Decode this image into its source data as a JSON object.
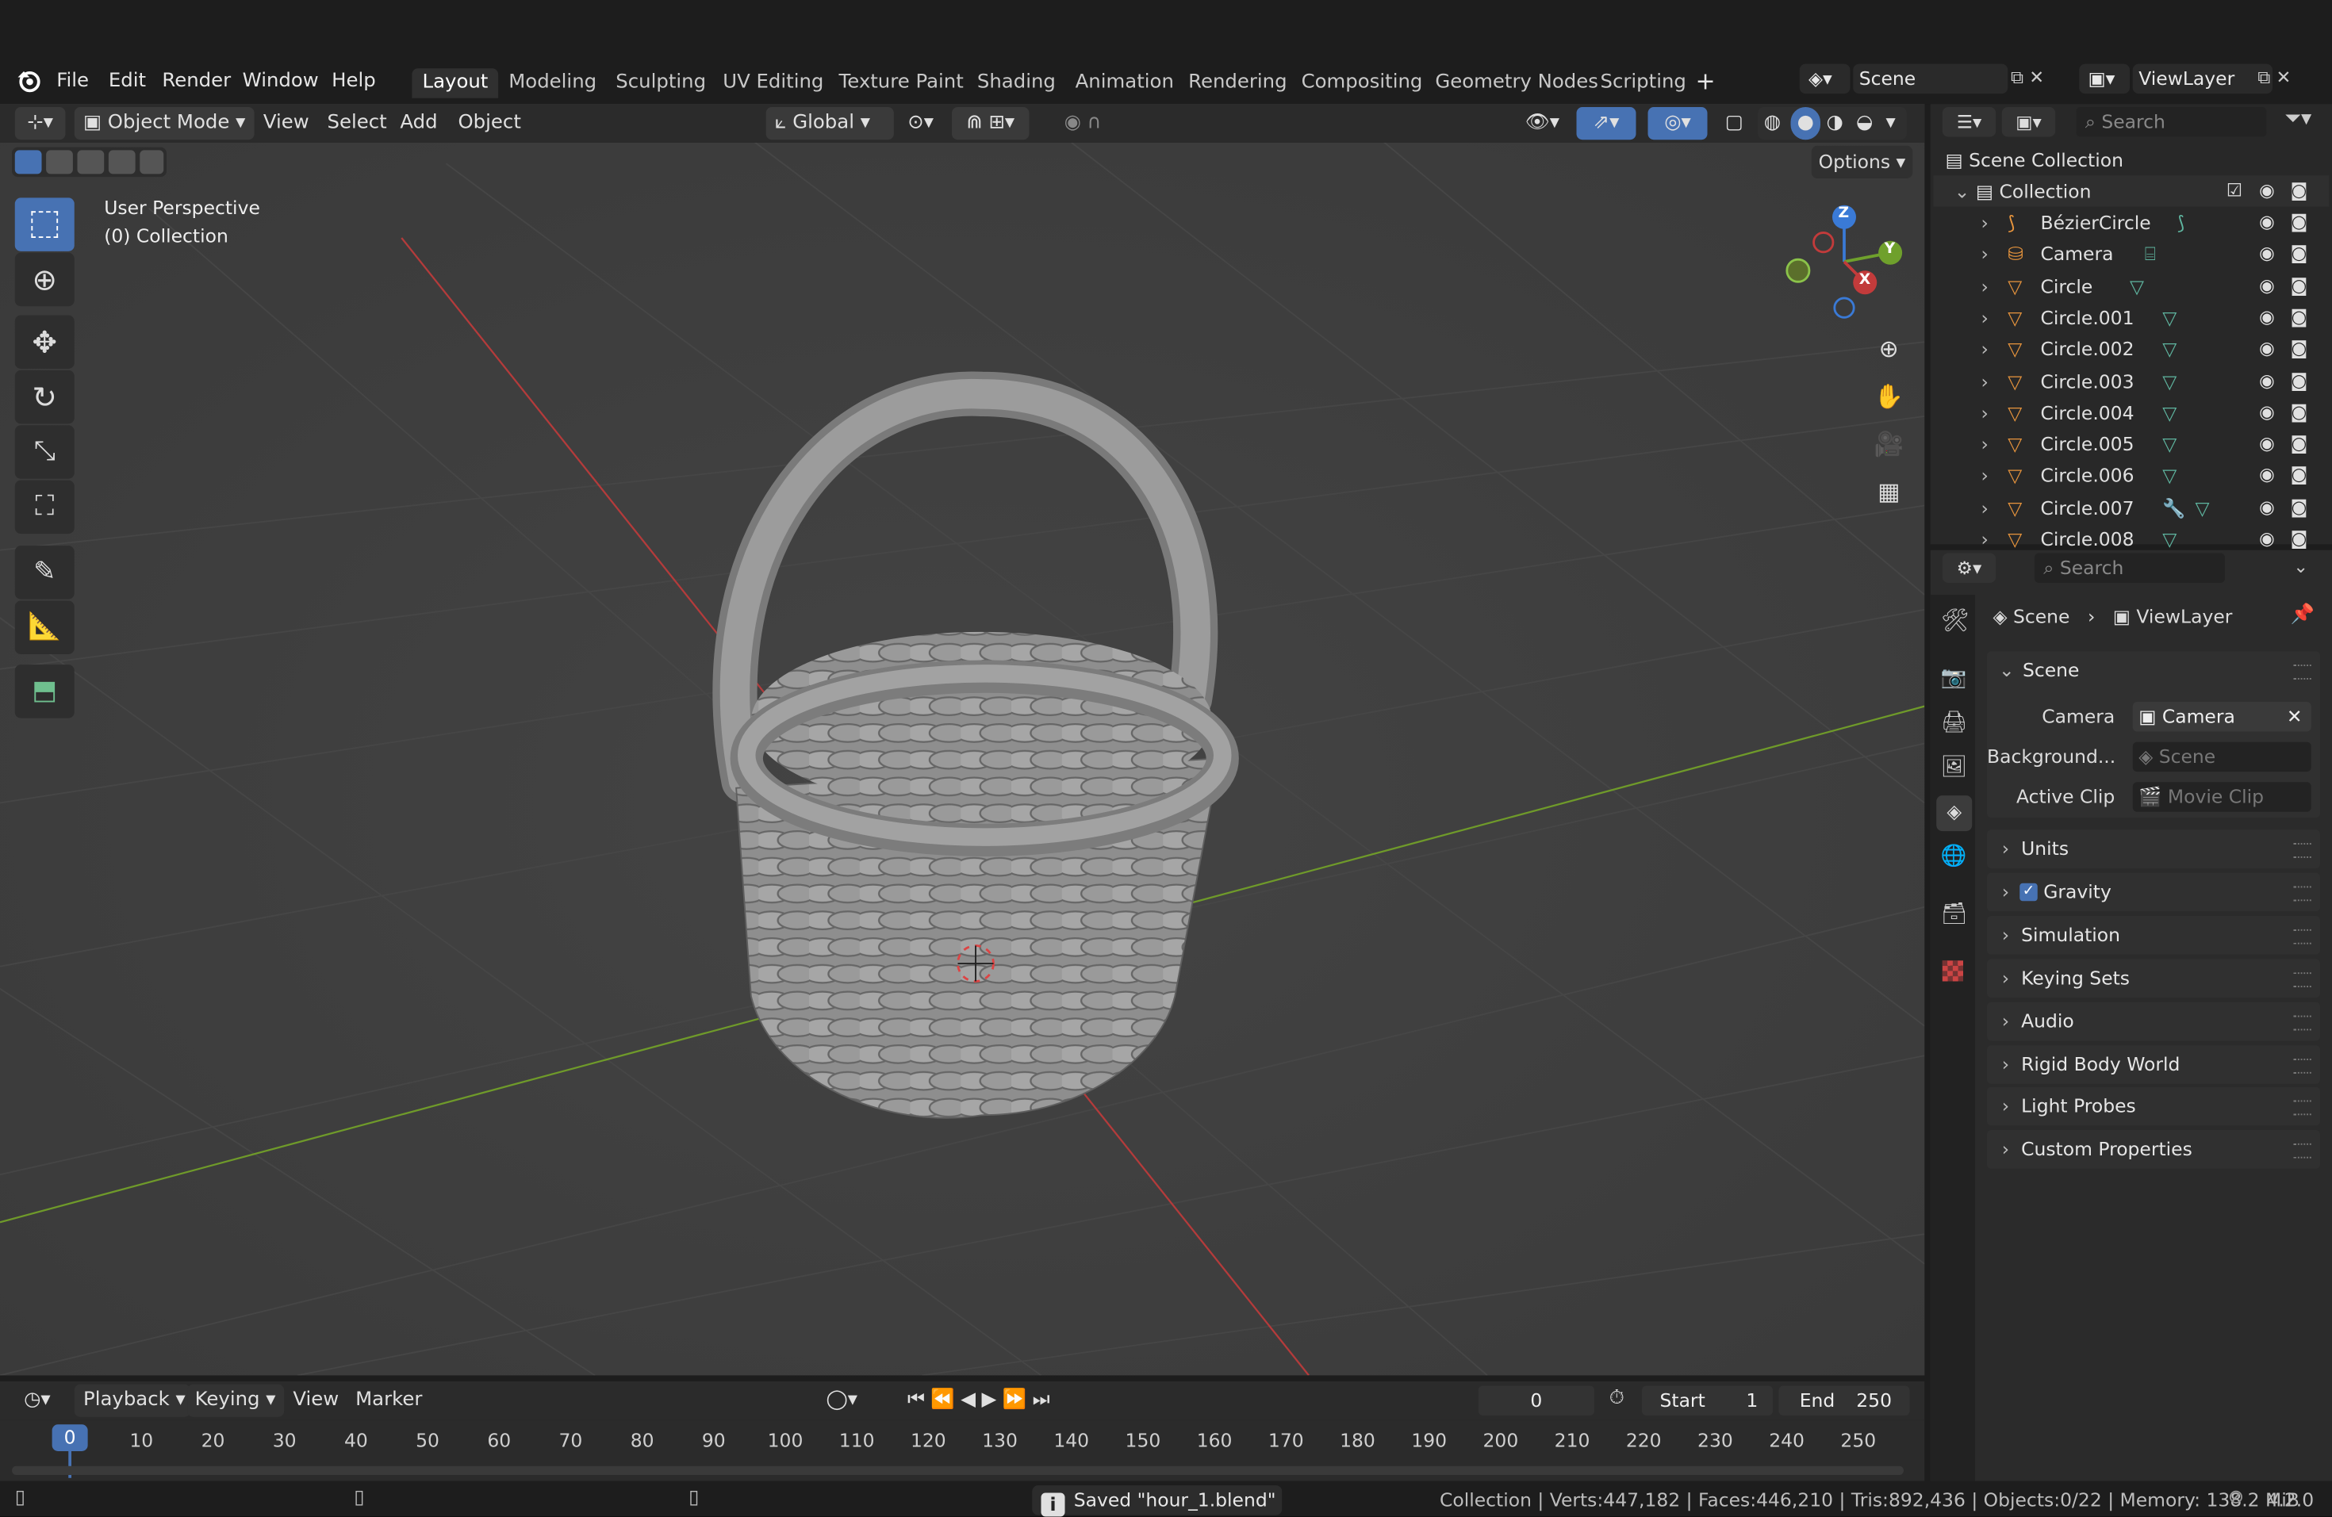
{
  "app": {
    "menu": [
      "File",
      "Edit",
      "Render",
      "Window",
      "Help"
    ],
    "workspaces": [
      "Layout",
      "Modeling",
      "Sculpting",
      "UV Editing",
      "Texture Paint",
      "Shading",
      "Animation",
      "Rendering",
      "Compositing",
      "Geometry Nodes",
      "Scripting"
    ],
    "active_workspace": "Layout",
    "scene_name": "Scene",
    "view_layer_name": "ViewLayer"
  },
  "viewport_header": {
    "mode": "Object Mode",
    "menus": [
      "View",
      "Select",
      "Add",
      "Object"
    ],
    "orientation": "Global",
    "options_label": "Options"
  },
  "viewport": {
    "perspective_label": "User Perspective",
    "collection_label": "(0) Collection",
    "gizmo_axes": [
      "Z",
      "Y",
      "X"
    ]
  },
  "outliner": {
    "search_placeholder": "Search",
    "root": "Scene Collection",
    "collection": "Collection",
    "items": [
      "BézierCircle",
      "Camera",
      "Circle",
      "Circle.001",
      "Circle.002",
      "Circle.003",
      "Circle.004",
      "Circle.005",
      "Circle.006",
      "Circle.007",
      "Circle.008"
    ]
  },
  "properties": {
    "search_placeholder": "Search",
    "breadcrumb_scene": "Scene",
    "breadcrumb_viewlayer": "ViewLayer",
    "scene_panel": "Scene",
    "camera_label": "Camera",
    "camera_value": "Camera",
    "background_label": "Background...",
    "background_value": "Scene",
    "active_clip_label": "Active Clip",
    "active_clip_value": "Movie Clip",
    "panels": [
      "Units",
      "Gravity",
      "Simulation",
      "Keying Sets",
      "Audio",
      "Rigid Body World",
      "Light Probes",
      "Custom Properties"
    ],
    "gravity_checked": true
  },
  "timeline": {
    "menus": [
      "Playback",
      "Keying",
      "View",
      "Marker"
    ],
    "current_frame": "0",
    "start_label": "Start",
    "start_value": "1",
    "end_label": "End",
    "end_value": "250",
    "ticks": [
      "0",
      "10",
      "20",
      "30",
      "40",
      "50",
      "60",
      "70",
      "80",
      "90",
      "100",
      "110",
      "120",
      "130",
      "140",
      "150",
      "160",
      "170",
      "180",
      "190",
      "200",
      "210",
      "220",
      "230",
      "240",
      "250"
    ]
  },
  "status": {
    "saved_message": "Saved \"hour_1.blend\"",
    "stats": "Collection | Verts:447,182 | Faces:446,210 | Tris:892,436 | Objects:0/22 | Memory: 138.2 MiB",
    "version": "4.2.0"
  },
  "colors": {
    "accent": "#4772b3",
    "x_axis": "#c23b3b",
    "y_axis": "#6fa02c",
    "z_axis": "#3a7ad6",
    "object_orange": "#e8953d",
    "mesh_green": "#5fb6a0"
  }
}
